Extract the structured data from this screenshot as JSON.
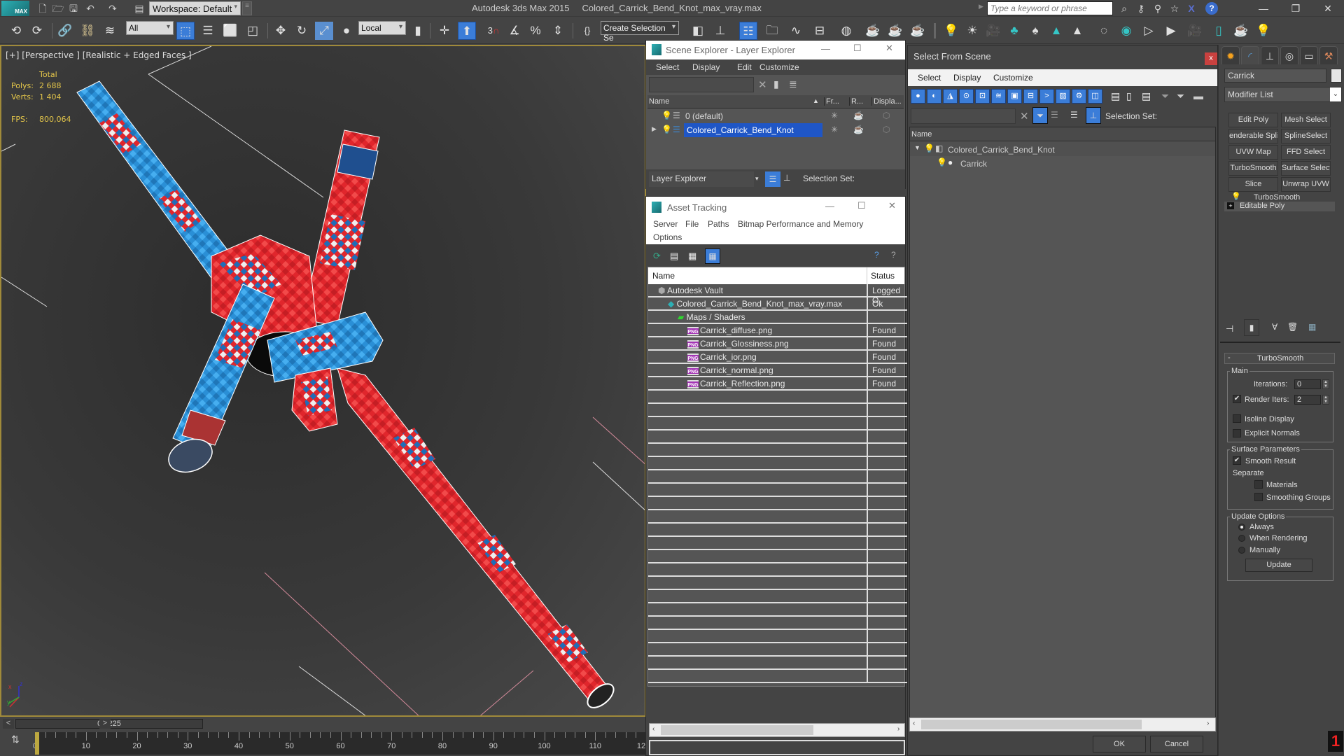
{
  "app": {
    "title": "Autodesk 3ds Max  2015",
    "file": "Colored_Carrick_Bend_Knot_max_vray.max",
    "logo": "MAX",
    "workspace": "Workspace: Default",
    "search_placeholder": "Type a keyword or phrase"
  },
  "toolbar": {
    "selection_filter": "All",
    "reference_coord": "Local",
    "named_selection": "Create Selection Se",
    "snap_3": "3"
  },
  "viewport": {
    "label": "[+] [Perspective ] [Realistic + Edged Faces ]",
    "stats": {
      "total_label": "Total",
      "polys_label": "Polys:",
      "polys_value": "2 688",
      "verts_label": "Verts:",
      "verts_value": "1 404",
      "fps_label": "FPS:",
      "fps_value": "800,064"
    },
    "axis": {
      "x": "x",
      "y": "y",
      "z": "z"
    }
  },
  "timeline": {
    "frame_display": "0 / 225",
    "prev": "<",
    "next": ">",
    "ticks": [
      "0",
      "10",
      "20",
      "30",
      "40",
      "50",
      "60",
      "70",
      "80",
      "90",
      "100",
      "110",
      "12"
    ],
    "current_frame": 0,
    "total_frames": 225
  },
  "scene_explorer": {
    "title": "Scene Explorer - Layer Explorer",
    "menu": [
      "Select",
      "Display",
      "Edit",
      "Customize"
    ],
    "columns": [
      "Name",
      "Fr...",
      "R...",
      "Displa..."
    ],
    "rows": [
      {
        "name": "0 (default)",
        "selected": false
      },
      {
        "name": "Colored_Carrick_Bend_Knot",
        "selected": true
      }
    ],
    "footer_dropdown": "Layer Explorer",
    "selection_set_label": "Selection Set:"
  },
  "asset_tracking": {
    "title": "Asset Tracking",
    "menu": [
      "Server",
      "File",
      "Paths",
      "Bitmap Performance and Memory",
      "Options"
    ],
    "columns": [
      "Name",
      "Status"
    ],
    "rows": [
      {
        "name": "Autodesk Vault",
        "status": "Logged O",
        "indent": 1,
        "icon": "vault"
      },
      {
        "name": "Colored_Carrick_Bend_Knot_max_vray.max",
        "status": "Ok",
        "indent": 2,
        "icon": "max"
      },
      {
        "name": "Maps / Shaders",
        "status": "",
        "indent": 3,
        "icon": "maps"
      },
      {
        "name": "Carrick_diffuse.png",
        "status": "Found",
        "indent": 4,
        "icon": "png"
      },
      {
        "name": "Carrick_Glossiness.png",
        "status": "Found",
        "indent": 4,
        "icon": "png"
      },
      {
        "name": "Carrick_ior.png",
        "status": "Found",
        "indent": 4,
        "icon": "png"
      },
      {
        "name": "Carrick_normal.png",
        "status": "Found",
        "indent": 4,
        "icon": "png"
      },
      {
        "name": "Carrick_Reflection.png",
        "status": "Found",
        "indent": 4,
        "icon": "png"
      }
    ],
    "png_badge": "PNG"
  },
  "select_from_scene": {
    "title": "Select From Scene",
    "close": "x",
    "menu": [
      "Select",
      "Display",
      "Customize"
    ],
    "selection_set_label": "Selection Set:",
    "column": "Name",
    "tree": [
      {
        "name": "Colored_Carrick_Bend_Knot",
        "level": 0
      },
      {
        "name": "Carrick",
        "level": 1
      }
    ],
    "ok": "OK",
    "cancel": "Cancel"
  },
  "command_panel": {
    "object_name": "Carrick",
    "object_color": "#e6e6e6",
    "modifier_list": "Modifier List",
    "modifier_buttons": [
      "Edit Poly",
      "Mesh Select",
      "enderable Splin",
      "SplineSelect",
      "UVW Map",
      "FFD Select",
      "TurboSmooth",
      "Surface Select",
      "Slice",
      "Unwrap UVW"
    ],
    "stack": [
      "TurboSmooth",
      "Editable Poly"
    ],
    "rollout": {
      "title": "TurboSmooth",
      "collapse": "-",
      "main_group": "Main",
      "iterations_label": "Iterations:",
      "iterations": "0",
      "render_iters_label": "Render Iters:",
      "render_iters": "2",
      "render_iters_checked": true,
      "isoline_display": "Isoline Display",
      "isoline_checked": false,
      "explicit_normals": "Explicit Normals",
      "explicit_checked": false,
      "surface_group": "Surface Parameters",
      "smooth_result": "Smooth Result",
      "smooth_checked": true,
      "separate_label": "Separate",
      "materials": "Materials",
      "materials_checked": false,
      "smoothing_groups": "Smoothing Groups",
      "smoothing_checked": false,
      "update_group": "Update Options",
      "always": "Always",
      "when_rendering": "When Rendering",
      "manually": "Manually",
      "selected_update": "Always",
      "update_button": "Update"
    }
  },
  "colors": {
    "accent_blue": "#3b7dd8",
    "viewport_border": "#a08a3a",
    "stat_yellow": "#e5c74a",
    "rope_red": "#e0262c",
    "rope_blue": "#2a8fd6",
    "close_red": "#c9413f"
  }
}
